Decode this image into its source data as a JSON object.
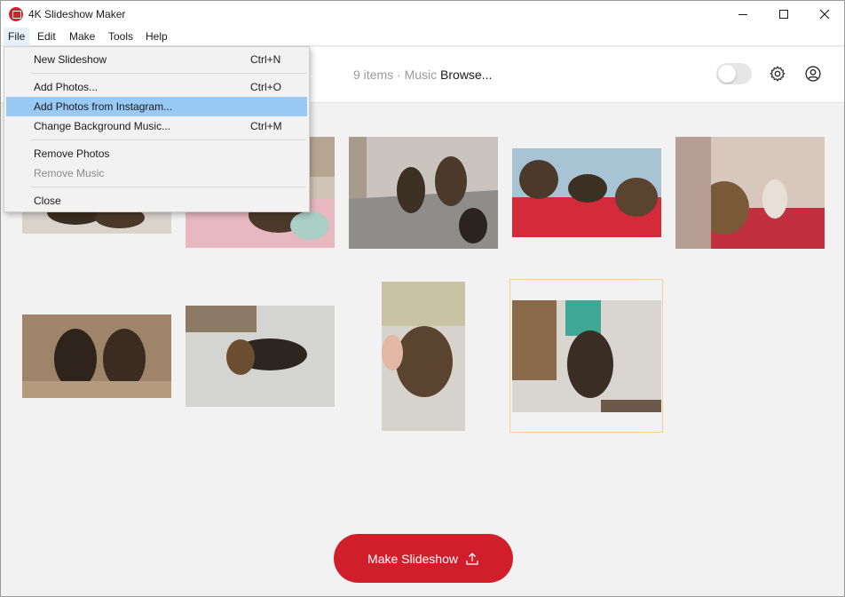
{
  "window": {
    "title": "4K Slideshow Maker",
    "accent_color": "#d01f2b",
    "controls": [
      "minimize-icon",
      "maximize-icon",
      "close-icon"
    ]
  },
  "menubar": {
    "items": [
      "File",
      "Edit",
      "Make",
      "Tools",
      "Help"
    ],
    "active": "File"
  },
  "file_menu": {
    "items": [
      {
        "label": "New Slideshow",
        "shortcut": "Ctrl+N"
      },
      {
        "label": "Add Photos...",
        "shortcut": "Ctrl+O"
      },
      {
        "label": "Add Photos from Instagram...",
        "shortcut": "",
        "highlighted": true
      },
      {
        "label": "Change Background Music...",
        "shortcut": "Ctrl+M"
      },
      {
        "label": "Remove Photos",
        "shortcut": ""
      },
      {
        "label": "Remove Music",
        "shortcut": "",
        "disabled": true
      },
      {
        "label": "Close",
        "shortcut": ""
      }
    ]
  },
  "toolbar": {
    "items_count": "9 items",
    "separator": " · ",
    "music_label": "Music",
    "browse_label": "Browse...",
    "toggle_on": false,
    "icons": [
      "gear-icon",
      "user-icon"
    ]
  },
  "photos": {
    "count": 9,
    "selected_index": 8
  },
  "make_button": {
    "label": "Make Slideshow",
    "icon": "upload-icon"
  }
}
